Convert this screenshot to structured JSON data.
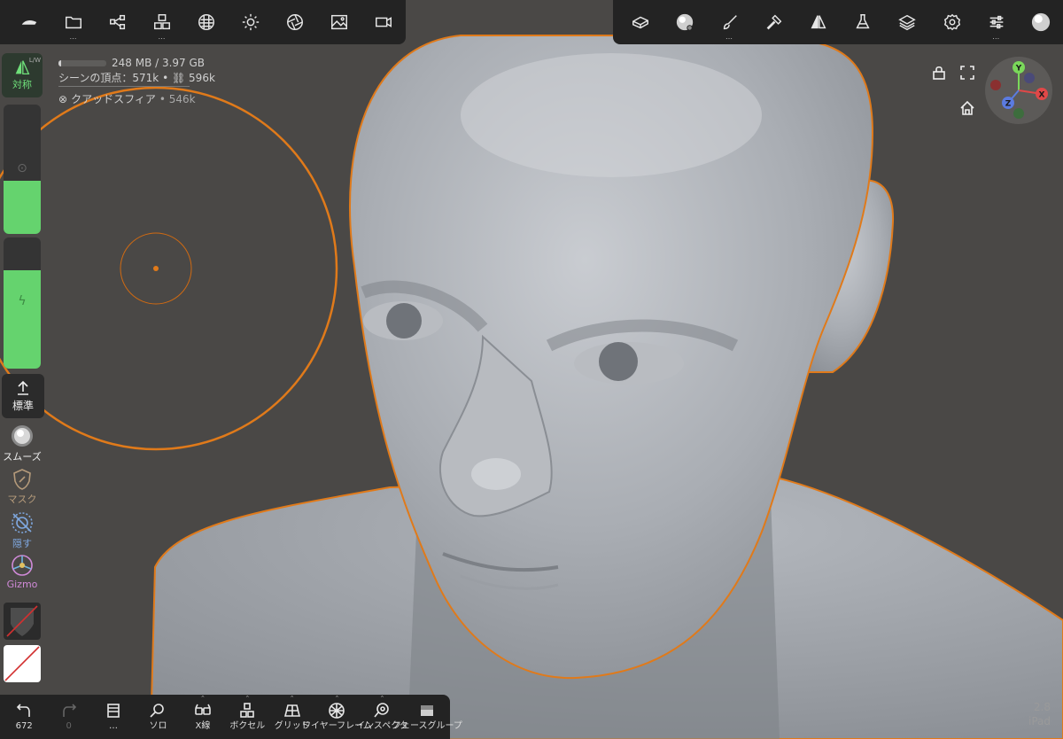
{
  "colors": {
    "accent_orange": "#e07a1a",
    "symmetry_green": "#6fe07a",
    "slider_green": "#65d36e",
    "mask_label": "#b59b7b",
    "hide_label": "#7fa8e0",
    "gizmo_label": "#d08ad8",
    "background": "#4a4846",
    "panel": "#232323"
  },
  "top_toolbar_left": {
    "items": [
      {
        "name": "nomad-logo-icon"
      },
      {
        "name": "files-icon",
        "more": "…"
      },
      {
        "name": "scene-icon"
      },
      {
        "name": "primitives-icon",
        "more": "…"
      },
      {
        "name": "material-icon"
      },
      {
        "name": "lighting-icon"
      },
      {
        "name": "camera-aperture-icon"
      },
      {
        "name": "background-image-icon"
      },
      {
        "name": "video-camera-icon"
      }
    ]
  },
  "top_toolbar_right": {
    "items": [
      {
        "name": "vr-headset-icon"
      },
      {
        "name": "matcap-icon"
      },
      {
        "name": "paint-brush-icon",
        "more": "…"
      },
      {
        "name": "hammer-icon"
      },
      {
        "name": "symmetry-icon"
      },
      {
        "name": "flask-icon"
      },
      {
        "name": "layers-icon"
      },
      {
        "name": "settings-gear-icon"
      },
      {
        "name": "sliders-icon",
        "more": "…"
      },
      {
        "name": "sphere-preview-icon"
      }
    ]
  },
  "info": {
    "memory": "248 MB / 3.97 GB",
    "memory_fraction": 0.06,
    "scene_vertices_label": "シーンの頂点：571k •",
    "linked_count": "596k",
    "object_name": "クアッドスフィア",
    "object_count": "• 546k"
  },
  "left_panel": {
    "symmetry_label": "対称",
    "lw_label": "L/W",
    "radius_slider": {
      "fraction": 0.41
    },
    "intensity_slider": {
      "fraction": 0.75
    },
    "standard_label": "標準",
    "tools": [
      {
        "key": "smooth",
        "label": "スムーズ"
      },
      {
        "key": "mask",
        "label": "マスク"
      },
      {
        "key": "hide",
        "label": "隠す"
      },
      {
        "key": "gizmo",
        "label": "Gizmo"
      }
    ]
  },
  "bottom_toolbar": {
    "items": [
      {
        "name": "undo",
        "label": "672"
      },
      {
        "name": "redo",
        "label": "0"
      },
      {
        "name": "history",
        "label": "…"
      },
      {
        "name": "solo",
        "label": "ソロ"
      },
      {
        "name": "xray",
        "label": "X線"
      },
      {
        "name": "voxel",
        "label": "ボクセル"
      },
      {
        "name": "grid",
        "label": "グリッド"
      },
      {
        "name": "wireframe",
        "label": "ワイヤーフレーム"
      },
      {
        "name": "inspector",
        "label": "インスペクタ"
      },
      {
        "name": "face-group",
        "label": "フェースグループ"
      }
    ]
  },
  "gizmo": {
    "x": "X",
    "y": "Y",
    "z": "Z"
  },
  "version": {
    "number": "2.8",
    "device": "iPad"
  }
}
